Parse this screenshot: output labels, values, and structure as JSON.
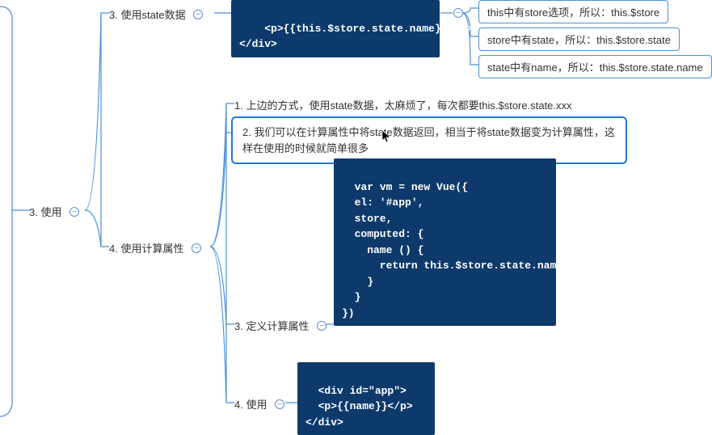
{
  "root": {
    "label": "3. 使用",
    "toggle": "–"
  },
  "node_state": {
    "label": "3. 使用state数据",
    "toggle": "–"
  },
  "code_state": "  <p>{{this.$store.state.name}}</p>\n</div>",
  "state_notes": [
    "this中有store选项，所以：this.$store",
    "store中有state，所以：this.$store.state",
    "state中有name，所以：this.$store.state.name"
  ],
  "explain1": "1. 上边的方式，使用state数据，太麻烦了，每次都要this.$store.state.xxx",
  "explain2": "2. 我们可以在计算属性中将state数据返回，相当于将state数据变为计算属性，这样在使用的时候就简单很多",
  "node_computed": {
    "label": "4. 使用计算属性",
    "toggle": "–"
  },
  "code_computed": "var vm = new Vue({\n  el: '#app',\n  store,\n  computed: {\n    name () {\n      return this.$store.state.name\n    }\n  }\n})",
  "node_define": {
    "label": "3. 定义计算属性",
    "toggle": "–"
  },
  "code_use": "<div id=\"app\">\n  <p>{{name}}</p>\n</div>",
  "node_use": {
    "label": "4. 使用",
    "toggle": "–"
  },
  "toggle_icon": "–"
}
